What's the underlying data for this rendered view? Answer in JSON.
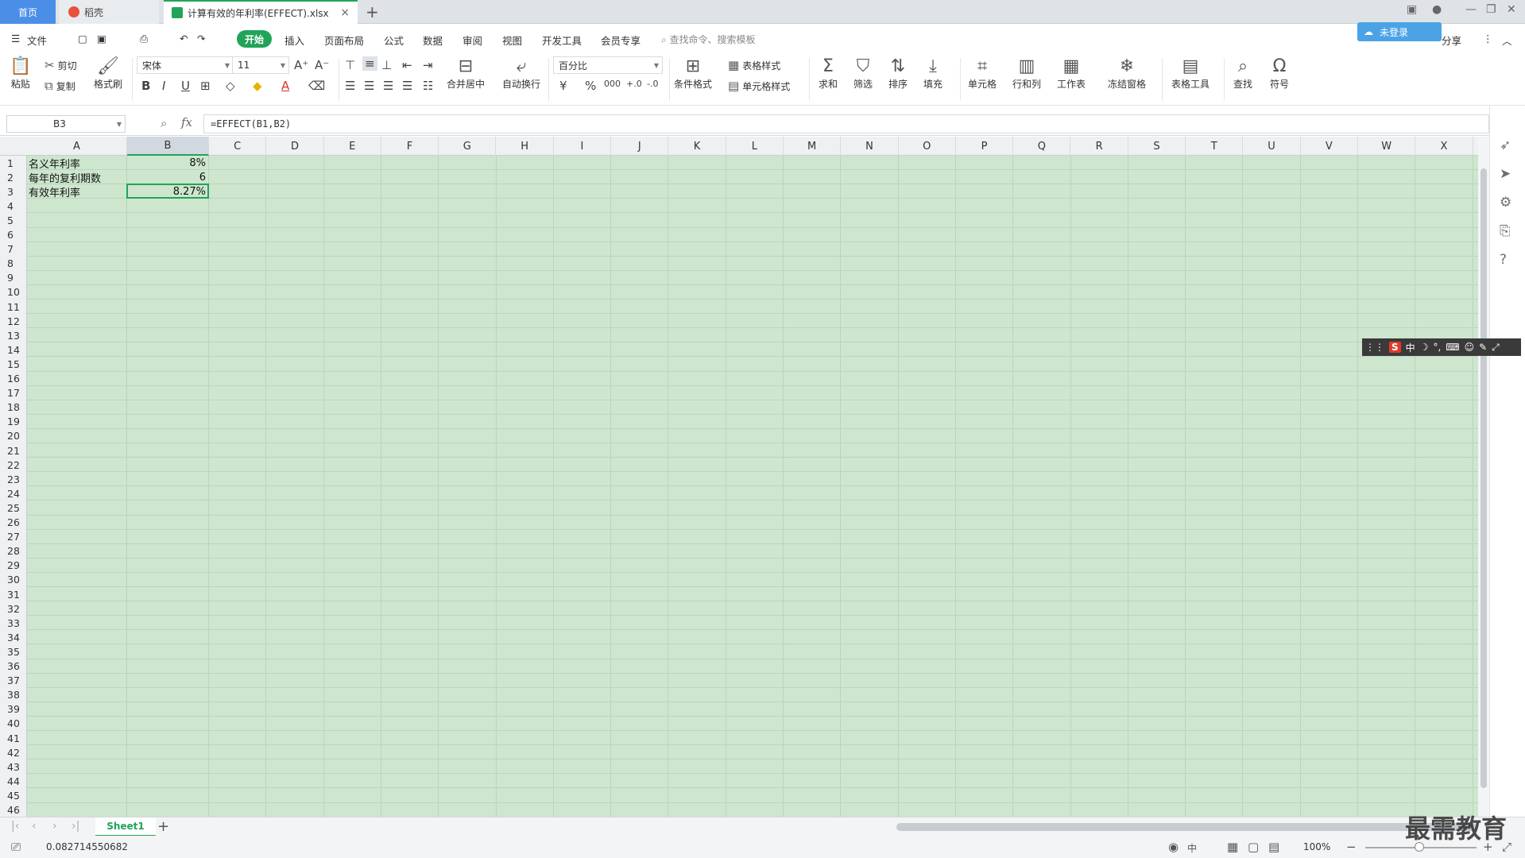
{
  "tabs": {
    "home": "首页",
    "doc": "稻壳",
    "file": "计算有效的年利率(EFFECT).xlsx",
    "close": "×",
    "add": "+"
  },
  "top_right": {
    "login": "未登录",
    "share": "分享"
  },
  "menu": {
    "file": "文件",
    "start": "开始",
    "items": [
      "插入",
      "页面布局",
      "公式",
      "数据",
      "审阅",
      "视图",
      "开发工具",
      "会员专享"
    ],
    "search_placeholder": "查找命令、搜索模板"
  },
  "ribbon": {
    "paste": "粘贴",
    "cut": "剪切",
    "copy": "复制",
    "format_painter": "格式刷",
    "font_name": "宋体",
    "font_size": "11",
    "merge_center": "合并居中",
    "wrap_text": "自动换行",
    "number_format": "百分比",
    "conditional_format": "条件格式",
    "table_style": "表格样式",
    "cell_style": "单元格样式",
    "sum": "求和",
    "filter": "筛选",
    "sort": "排序",
    "fill": "填充",
    "cells": "单元格",
    "rows_cols": "行和列",
    "worksheet": "工作表",
    "freeze": "冻结窗格",
    "table_tools": "表格工具",
    "find": "查找",
    "symbol": "符号"
  },
  "formula_bar": {
    "name_box": "B3",
    "fx": "fx",
    "formula": "=EFFECT(B1,B2)"
  },
  "columns": [
    "A",
    "B",
    "C",
    "D",
    "E",
    "F",
    "G",
    "H",
    "I",
    "J",
    "K",
    "L",
    "M",
    "N",
    "O",
    "P",
    "Q",
    "R",
    "S",
    "T",
    "U",
    "V",
    "W",
    "X"
  ],
  "rows": [
    "1",
    "2",
    "3",
    "4",
    "5",
    "6",
    "7",
    "8",
    "9",
    "10",
    "11",
    "12",
    "13",
    "14",
    "15",
    "16",
    "17",
    "18",
    "19",
    "20",
    "21",
    "22",
    "23",
    "24",
    "25",
    "26",
    "27",
    "28",
    "29",
    "30",
    "31",
    "32",
    "33",
    "34",
    "35",
    "36",
    "37",
    "38",
    "39",
    "40",
    "41",
    "42",
    "43",
    "44",
    "45",
    "46"
  ],
  "cells": {
    "A1": "名义年利率",
    "B1": "8%",
    "A2": "每年的复利期数",
    "B2": "6",
    "A3": "有效年利率",
    "B3": "8.27%"
  },
  "sheet": {
    "name": "Sheet1",
    "add": "+"
  },
  "status": {
    "value": "0.082714550682",
    "ime": "中",
    "zoom": "100%"
  },
  "ime_bar": {
    "logo": "S",
    "mode": "中"
  },
  "watermark": "最需教育",
  "colors": {
    "accent": "#22a35a",
    "grid_bg": "#cde6cd",
    "home_tab": "#4b8ee8"
  }
}
